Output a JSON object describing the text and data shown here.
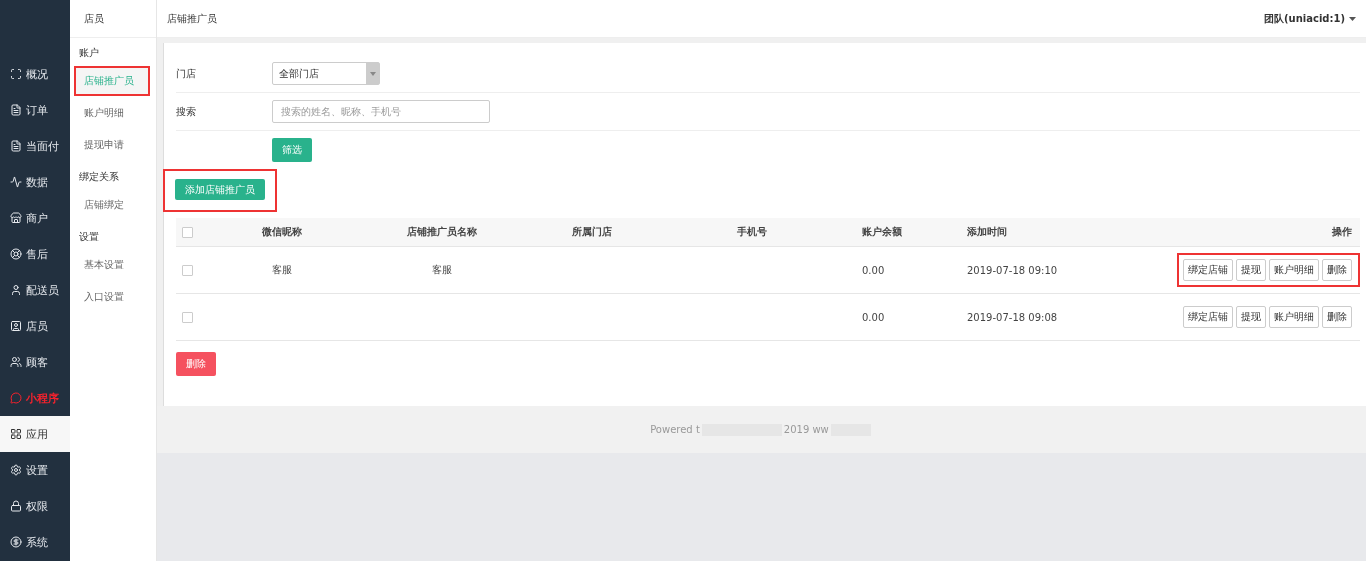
{
  "sidebar": {
    "items": [
      {
        "label": "概况",
        "highlighted": false,
        "selected": false
      },
      {
        "label": "订单",
        "highlighted": false,
        "selected": false
      },
      {
        "label": "当面付",
        "highlighted": false,
        "selected": false
      },
      {
        "label": "数据",
        "highlighted": false,
        "selected": false
      },
      {
        "label": "商户",
        "highlighted": false,
        "selected": false
      },
      {
        "label": "售后",
        "highlighted": false,
        "selected": false
      },
      {
        "label": "配送员",
        "highlighted": false,
        "selected": false
      },
      {
        "label": "店员",
        "highlighted": false,
        "selected": false
      },
      {
        "label": "顾客",
        "highlighted": false,
        "selected": false
      },
      {
        "label": "小程序",
        "highlighted": true,
        "selected": false
      },
      {
        "label": "应用",
        "highlighted": false,
        "selected": true
      },
      {
        "label": "设置",
        "highlighted": false,
        "selected": false
      },
      {
        "label": "权限",
        "highlighted": false,
        "selected": false
      },
      {
        "label": "系统",
        "highlighted": false,
        "selected": false
      }
    ]
  },
  "submenu": {
    "title": "店员",
    "groups": [
      {
        "title": "账户",
        "items": [
          {
            "label": "店铺推广员",
            "selected": true,
            "highlighted": true
          },
          {
            "label": "账户明细",
            "selected": false,
            "highlighted": false
          },
          {
            "label": "提现申请",
            "selected": false,
            "highlighted": false
          }
        ]
      },
      {
        "title": "绑定关系",
        "items": [
          {
            "label": "店铺绑定",
            "selected": false,
            "highlighted": false
          }
        ]
      },
      {
        "title": "设置",
        "items": [
          {
            "label": "基本设置",
            "selected": false,
            "highlighted": false
          },
          {
            "label": "入口设置",
            "selected": false,
            "highlighted": false
          }
        ]
      }
    ]
  },
  "topbar": {
    "title": "店铺推广员",
    "account": "团队(uniacid:1)"
  },
  "filter": {
    "store_label": "门店",
    "store_value": "全部门店",
    "search_label": "搜索",
    "search_placeholder": "搜索的姓名、昵称、手机号",
    "submit": "筛选"
  },
  "add_button": {
    "label": "添加店铺推广员",
    "highlighted": true
  },
  "table": {
    "select_all_checked": false,
    "columns": [
      "微信昵称",
      "店铺推广员名称",
      "所属门店",
      "手机号",
      "账户余额",
      "添加时间",
      "操作"
    ],
    "rows": [
      {
        "checked": false,
        "nickname": "客服",
        "name": "客服",
        "balance": "0.00",
        "time": "2019-07-18 09:10",
        "actions": [
          "绑定店铺",
          "提现",
          "账户明细",
          "删除"
        ],
        "highlighted": true
      },
      {
        "checked": false,
        "balance": "0.00",
        "time": "2019-07-18 09:08",
        "actions": [
          "绑定店铺",
          "提现",
          "账户明细",
          "删除"
        ],
        "highlighted": false
      }
    ]
  },
  "delete_button": "删除",
  "footer": {
    "left": "Powered t",
    "right": "2019 ww"
  }
}
